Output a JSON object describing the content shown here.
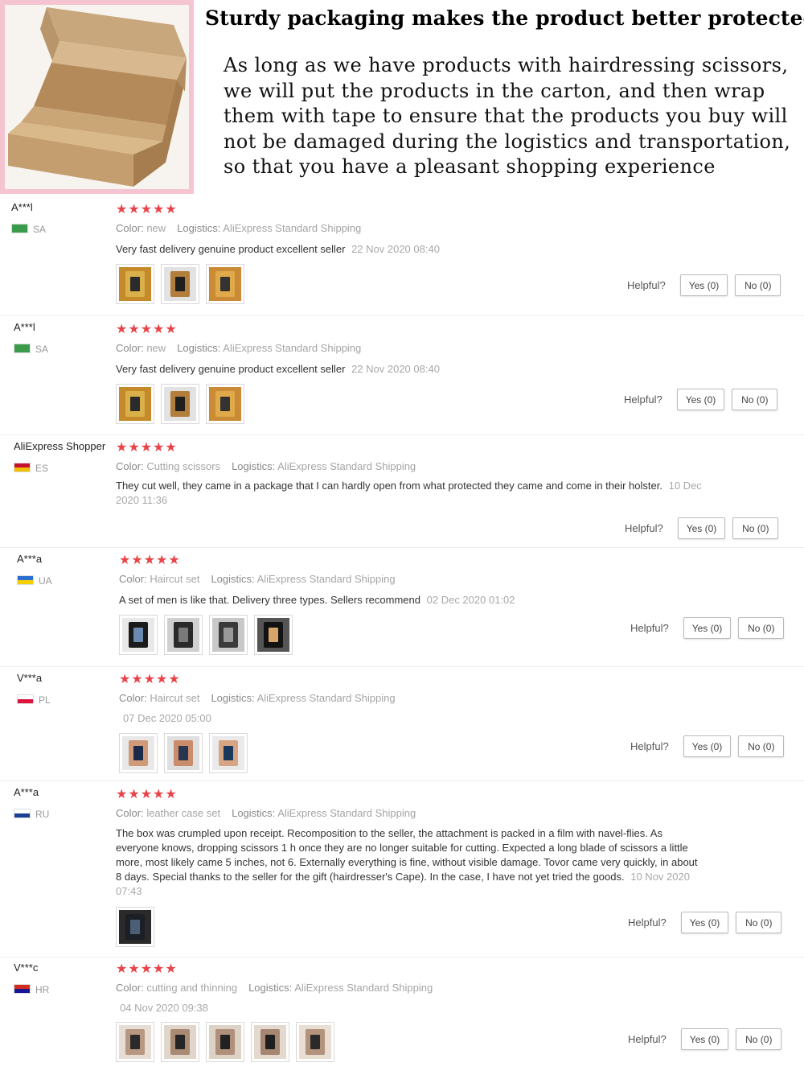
{
  "packaging": {
    "title": "Sturdy packaging makes the product better protected",
    "description": "As long as we have products with hairdressing scissors, we will put the products in the carton, and then wrap them with tape to ensure that the products you buy will not be damaged during the logistics and transportation, so that you have a pleasant shopping experience"
  },
  "labels": {
    "color": "Color:",
    "logistics": "Logistics:",
    "helpful": "Helpful?",
    "stars": "★★★★★"
  },
  "reviews": [
    {
      "user": "A***l",
      "country": "SA",
      "flag_colors": [
        "#3a9c4a",
        "#3a9c4a"
      ],
      "color": "new",
      "logistics": "AliExpress Standard Shipping",
      "comment": "Very fast delivery genuine product excellent seller",
      "date": "22 Nov 2020 08:40",
      "yes": "Yes (0)",
      "no": "No (0)",
      "images": 3,
      "photo_kind": "box"
    },
    {
      "user": "A***l",
      "country": "SA",
      "flag_colors": [
        "#3a9c4a",
        "#3a9c4a"
      ],
      "color": "new",
      "logistics": "AliExpress Standard Shipping",
      "comment": "Very fast delivery genuine product excellent seller",
      "date": "22 Nov 2020 08:40",
      "yes": "Yes (0)",
      "no": "No (0)",
      "images": 3,
      "photo_kind": "box"
    },
    {
      "user": "AliExpress Shopper",
      "country": "ES",
      "flag_colors": [
        "#c8102e",
        "#f1bf00"
      ],
      "color": "Cutting scissors",
      "logistics": "AliExpress Standard Shipping",
      "comment": "They cut well, they came in a package that I can hardly open from what protected they came and come in their holster.",
      "date": "10 Dec 2020 11:36",
      "yes": "Yes (0)",
      "no": "No (0)",
      "images": 0,
      "photo_kind": "none"
    },
    {
      "user": "A***a",
      "country": "UA",
      "flag_colors": [
        "#2a6fd0",
        "#f5d000"
      ],
      "color": "Haircut set",
      "logistics": "AliExpress Standard Shipping",
      "comment": "A set of men is like that. Delivery three types. Sellers recommend",
      "date": "02 Dec 2020 01:02",
      "yes": "Yes (0)",
      "no": "No (0)",
      "images": 4,
      "photo_kind": "case"
    },
    {
      "user": "V***a",
      "country": "PL",
      "flag_colors": [
        "#ffffff",
        "#dc143c"
      ],
      "color": "Haircut set",
      "logistics": "AliExpress Standard Shipping",
      "comment": "",
      "date": "07 Dec 2020 05:00",
      "yes": "Yes (0)",
      "no": "No (0)",
      "images": 3,
      "photo_kind": "hand"
    },
    {
      "user": "A***a",
      "country": "RU",
      "flag_colors": [
        "#ffffff",
        "#1c3f95"
      ],
      "color": "leather case set",
      "logistics": "AliExpress Standard Shipping",
      "comment": "The box was crumpled upon receipt. Recomposition to the seller, the attachment is packed in a film with navel-flies. As everyone knows, dropping scissors 1 h once they are no longer suitable for cutting. Expected a long blade of scissors a little more, most likely came 5 inches, not 6. Externally everything is fine, without visible damage. Tovor came very quickly, in about 8 days. Special thanks to the seller for the gift (hairdresser's Cape). In the case, I have not yet tried the goods.",
      "date": "10 Nov 2020 07:43",
      "yes": "Yes (0)",
      "no": "No (0)",
      "images": 1,
      "photo_kind": "dark"
    },
    {
      "user": "V***c",
      "country": "HR",
      "flag_colors": [
        "#d52b1e",
        "#171796"
      ],
      "color": "cutting and thinning",
      "logistics": "AliExpress Standard Shipping",
      "comment": "",
      "date": "04 Nov 2020 09:38",
      "yes": "Yes (0)",
      "no": "No (0)",
      "images": 5,
      "photo_kind": "scissors"
    }
  ]
}
